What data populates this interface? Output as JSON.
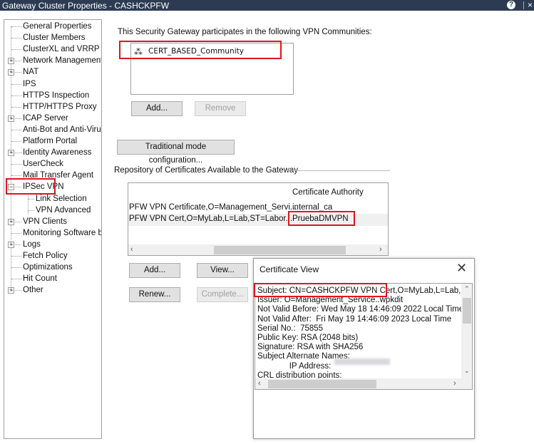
{
  "window": {
    "title": "Gateway Cluster Properties - CASHCKPFW",
    "help_icon": "?",
    "close_icon": "×"
  },
  "tree": [
    {
      "label": "General Properties",
      "expander": ""
    },
    {
      "label": "Cluster Members",
      "expander": ""
    },
    {
      "label": "ClusterXL and VRRP",
      "expander": ""
    },
    {
      "label": "Network Management",
      "expander": "+"
    },
    {
      "label": "NAT",
      "expander": "+"
    },
    {
      "label": "IPS",
      "expander": ""
    },
    {
      "label": "HTTPS Inspection",
      "expander": ""
    },
    {
      "label": "HTTP/HTTPS Proxy",
      "expander": ""
    },
    {
      "label": "ICAP Server",
      "expander": "+"
    },
    {
      "label": "Anti-Bot and Anti-Virus",
      "expander": ""
    },
    {
      "label": "Platform Portal",
      "expander": ""
    },
    {
      "label": "Identity Awareness",
      "expander": "+"
    },
    {
      "label": "UserCheck",
      "expander": ""
    },
    {
      "label": "Mail Transfer Agent",
      "expander": ""
    },
    {
      "label": "IPSec VPN",
      "expander": "-",
      "selected": true
    },
    {
      "label": "Link Selection",
      "expander": "",
      "child": true
    },
    {
      "label": "VPN Advanced",
      "expander": "",
      "child": true
    },
    {
      "label": "VPN Clients",
      "expander": "+"
    },
    {
      "label": "Monitoring Software bla",
      "expander": ""
    },
    {
      "label": "Logs",
      "expander": "+"
    },
    {
      "label": "Fetch Policy",
      "expander": ""
    },
    {
      "label": "Optimizations",
      "expander": ""
    },
    {
      "label": "Hit Count",
      "expander": ""
    },
    {
      "label": "Other",
      "expander": "+"
    }
  ],
  "communities": {
    "label": "This Security Gateway participates in the following VPN Communities:",
    "items": [
      "CERT_BASED_Community"
    ],
    "add": "Add...",
    "remove": "Remove"
  },
  "traditional_button": "Traditional mode configuration...",
  "repository": {
    "label": "Repository of Certificates Available to the Gateway",
    "columns": [
      "",
      "Certificate Authority"
    ],
    "rows": [
      [
        "PFW VPN Certificate,O=Management_Servi...",
        "internal_ca"
      ],
      [
        "PFW VPN Cert,O=MyLab,L=Lab,ST=Labor...",
        "PruebaDMVPN"
      ]
    ],
    "buttons": {
      "add": "Add...",
      "view": "View...",
      "renew": "Renew...",
      "complete": "Complete..."
    }
  },
  "cert_view": {
    "title": "Certificate View",
    "lines": [
      "Subject: CN=CASHCKPFW VPN Cert,O=MyLab,L=Lab,ST=",
      "Issuer: O=Management_Service..wpkdit",
      "Not Valid Before: Wed May 18 14:46:09 2022 Local Time",
      "Not Valid After:  Fri May 19 14:46:09 2023 Local Time",
      "Serial No.:  75855",
      "Public Key: RSA (2048 bits)",
      "Signature: RSA with SHA256",
      "Subject Alternate Names:",
      "              IP Address:",
      "CRL distribution points:"
    ]
  },
  "colors": {
    "titlebar": "#2d3b52",
    "highlight": "#e0141e"
  }
}
